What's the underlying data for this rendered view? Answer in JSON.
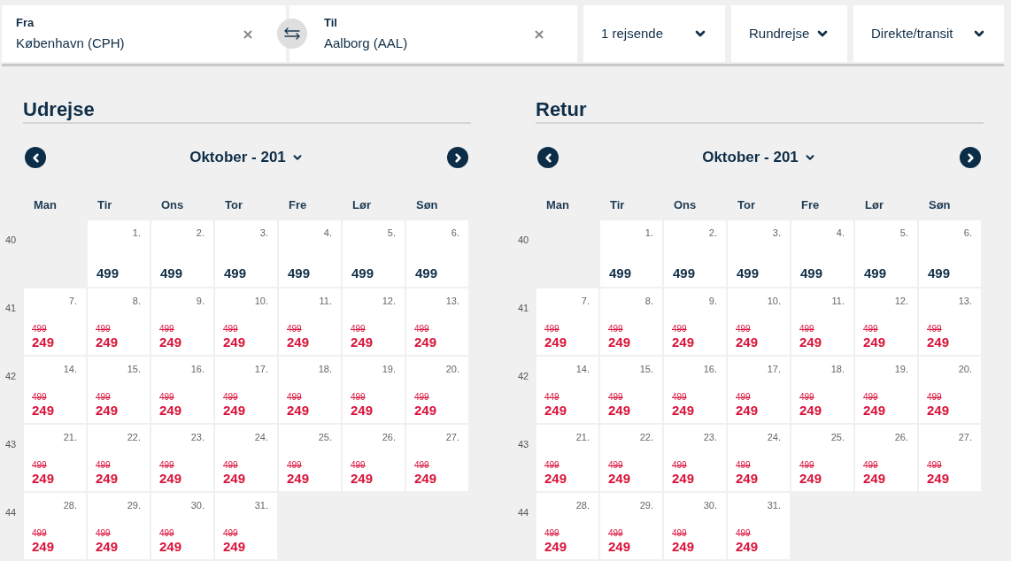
{
  "search_bar": {
    "from": {
      "label": "Fra",
      "value": "København (CPH)"
    },
    "to": {
      "label": "Til",
      "value": "Aalborg (AAL)"
    },
    "dropdowns": [
      {
        "label": "1 rejsende"
      },
      {
        "label": "Rundrejse"
      },
      {
        "label": "Direkte/transit"
      }
    ]
  },
  "calendars": [
    {
      "title": "Udrejse",
      "month": "Oktober - 201",
      "weekdays": [
        "Man",
        "Tir",
        "Ons",
        "Tor",
        "Fre",
        "Lør",
        "Søn"
      ],
      "weeks": [
        {
          "number": "40",
          "days": [
            {
              "kind": "empty"
            },
            {
              "kind": "regular",
              "date": "1.",
              "price": "499"
            },
            {
              "kind": "regular",
              "date": "2.",
              "price": "499"
            },
            {
              "kind": "regular",
              "date": "3.",
              "price": "499"
            },
            {
              "kind": "regular",
              "date": "4.",
              "price": "499"
            },
            {
              "kind": "regular",
              "date": "5.",
              "price": "499"
            },
            {
              "kind": "regular",
              "date": "6.",
              "price": "499"
            }
          ]
        },
        {
          "number": "41",
          "days": [
            {
              "kind": "discount",
              "date": "7.",
              "old_price": "499",
              "price": "249"
            },
            {
              "kind": "discount",
              "date": "8.",
              "old_price": "499",
              "price": "249"
            },
            {
              "kind": "discount",
              "date": "9.",
              "old_price": "499",
              "price": "249"
            },
            {
              "kind": "discount",
              "date": "10.",
              "old_price": "499",
              "price": "249"
            },
            {
              "kind": "discount",
              "date": "11.",
              "old_price": "499",
              "price": "249"
            },
            {
              "kind": "discount",
              "date": "12.",
              "old_price": "499",
              "price": "249"
            },
            {
              "kind": "discount",
              "date": "13.",
              "old_price": "499",
              "price": "249"
            }
          ]
        },
        {
          "number": "42",
          "days": [
            {
              "kind": "discount",
              "date": "14.",
              "old_price": "499",
              "price": "249"
            },
            {
              "kind": "discount",
              "date": "15.",
              "old_price": "499",
              "price": "249"
            },
            {
              "kind": "discount",
              "date": "16.",
              "old_price": "499",
              "price": "249"
            },
            {
              "kind": "discount",
              "date": "17.",
              "old_price": "499",
              "price": "249"
            },
            {
              "kind": "discount",
              "date": "18.",
              "old_price": "499",
              "price": "249"
            },
            {
              "kind": "discount",
              "date": "19.",
              "old_price": "499",
              "price": "249"
            },
            {
              "kind": "discount",
              "date": "20.",
              "old_price": "499",
              "price": "249"
            }
          ]
        },
        {
          "number": "43",
          "days": [
            {
              "kind": "discount",
              "date": "21.",
              "old_price": "499",
              "price": "249"
            },
            {
              "kind": "discount",
              "date": "22.",
              "old_price": "499",
              "price": "249"
            },
            {
              "kind": "discount",
              "date": "23.",
              "old_price": "499",
              "price": "249"
            },
            {
              "kind": "discount",
              "date": "24.",
              "old_price": "499",
              "price": "249"
            },
            {
              "kind": "discount",
              "date": "25.",
              "old_price": "499",
              "price": "249"
            },
            {
              "kind": "discount",
              "date": "26.",
              "old_price": "499",
              "price": "249"
            },
            {
              "kind": "discount",
              "date": "27.",
              "old_price": "499",
              "price": "249"
            }
          ]
        },
        {
          "number": "44",
          "days": [
            {
              "kind": "discount",
              "date": "28.",
              "old_price": "499",
              "price": "249"
            },
            {
              "kind": "discount",
              "date": "29.",
              "old_price": "499",
              "price": "249"
            },
            {
              "kind": "discount",
              "date": "30.",
              "old_price": "499",
              "price": "249"
            },
            {
              "kind": "discount",
              "date": "31.",
              "old_price": "499",
              "price": "249"
            }
          ]
        }
      ]
    },
    {
      "title": "Retur",
      "month": "Oktober - 201",
      "weekdays": [
        "Man",
        "Tir",
        "Ons",
        "Tor",
        "Fre",
        "Lør",
        "Søn"
      ],
      "weeks": [
        {
          "number": "40",
          "days": [
            {
              "kind": "empty"
            },
            {
              "kind": "regular",
              "date": "1.",
              "price": "499"
            },
            {
              "kind": "regular",
              "date": "2.",
              "price": "499"
            },
            {
              "kind": "regular",
              "date": "3.",
              "price": "499"
            },
            {
              "kind": "regular",
              "date": "4.",
              "price": "499"
            },
            {
              "kind": "regular",
              "date": "5.",
              "price": "499"
            },
            {
              "kind": "regular",
              "date": "6.",
              "price": "499"
            }
          ]
        },
        {
          "number": "41",
          "days": [
            {
              "kind": "discount",
              "date": "7.",
              "old_price": "499",
              "price": "249"
            },
            {
              "kind": "discount",
              "date": "8.",
              "old_price": "499",
              "price": "249"
            },
            {
              "kind": "discount",
              "date": "9.",
              "old_price": "499",
              "price": "249"
            },
            {
              "kind": "discount",
              "date": "10.",
              "old_price": "499",
              "price": "249"
            },
            {
              "kind": "discount",
              "date": "11.",
              "old_price": "499",
              "price": "249"
            },
            {
              "kind": "discount",
              "date": "12.",
              "old_price": "499",
              "price": "249"
            },
            {
              "kind": "discount",
              "date": "13.",
              "old_price": "499",
              "price": "249"
            }
          ]
        },
        {
          "number": "42",
          "days": [
            {
              "kind": "discount",
              "date": "14.",
              "old_price": "449",
              "price": "249"
            },
            {
              "kind": "discount",
              "date": "15.",
              "old_price": "499",
              "price": "249"
            },
            {
              "kind": "discount",
              "date": "16.",
              "old_price": "499",
              "price": "249"
            },
            {
              "kind": "discount",
              "date": "17.",
              "old_price": "499",
              "price": "249"
            },
            {
              "kind": "discount",
              "date": "18.",
              "old_price": "499",
              "price": "249"
            },
            {
              "kind": "discount",
              "date": "19.",
              "old_price": "499",
              "price": "249"
            },
            {
              "kind": "discount",
              "date": "20.",
              "old_price": "499",
              "price": "249"
            }
          ]
        },
        {
          "number": "43",
          "days": [
            {
              "kind": "discount",
              "date": "21.",
              "old_price": "499",
              "price": "249"
            },
            {
              "kind": "discount",
              "date": "22.",
              "old_price": "499",
              "price": "249"
            },
            {
              "kind": "discount",
              "date": "23.",
              "old_price": "499",
              "price": "249"
            },
            {
              "kind": "discount",
              "date": "24.",
              "old_price": "499",
              "price": "249"
            },
            {
              "kind": "discount",
              "date": "25.",
              "old_price": "499",
              "price": "249"
            },
            {
              "kind": "discount",
              "date": "26.",
              "old_price": "499",
              "price": "249"
            },
            {
              "kind": "discount",
              "date": "27.",
              "old_price": "499",
              "price": "249"
            }
          ]
        },
        {
          "number": "44",
          "days": [
            {
              "kind": "discount",
              "date": "28.",
              "old_price": "499",
              "price": "249"
            },
            {
              "kind": "discount",
              "date": "29.",
              "old_price": "499",
              "price": "249"
            },
            {
              "kind": "discount",
              "date": "30.",
              "old_price": "499",
              "price": "249"
            },
            {
              "kind": "discount",
              "date": "31.",
              "old_price": "499",
              "price": "249"
            }
          ]
        }
      ]
    }
  ]
}
